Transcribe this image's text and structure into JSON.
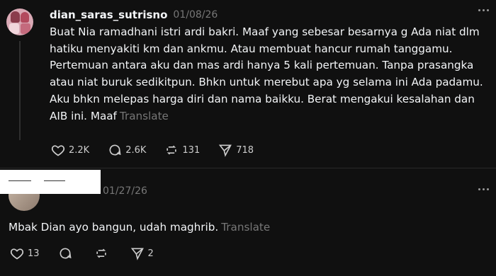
{
  "post1": {
    "username": "dian_saras_sutrisno",
    "date": "01/08/26",
    "lines": [
      "Buat Nia ramadhani istri ardi bakri. Maaf yang sebesar besarnya g Ada niat dlm",
      "hatiku menyakiti km dan ankmu. Atau membuat hancur rumah tanggamu.",
      "Pertemuan antara aku dan mas ardi hanya 5 kali pertemuan. Tanpa prasangka",
      "atau niat buruk sedikitpun. Bhkn untuk merebut apa yg selama ini Ada padamu.",
      "Aku bhkn melepas harga diri dan nama baikku. Berat mengakui kesalahan dan",
      "AIB ini. Maaf"
    ],
    "translate": "Translate",
    "likes": "2.2K",
    "comments": "2.6K",
    "reposts": "131",
    "shares": "718"
  },
  "post2": {
    "date": "01/27/26",
    "text": "Mbak Dian ayo bangun, udah maghrib.",
    "translate": "Translate",
    "likes": "13",
    "shares": "2"
  }
}
